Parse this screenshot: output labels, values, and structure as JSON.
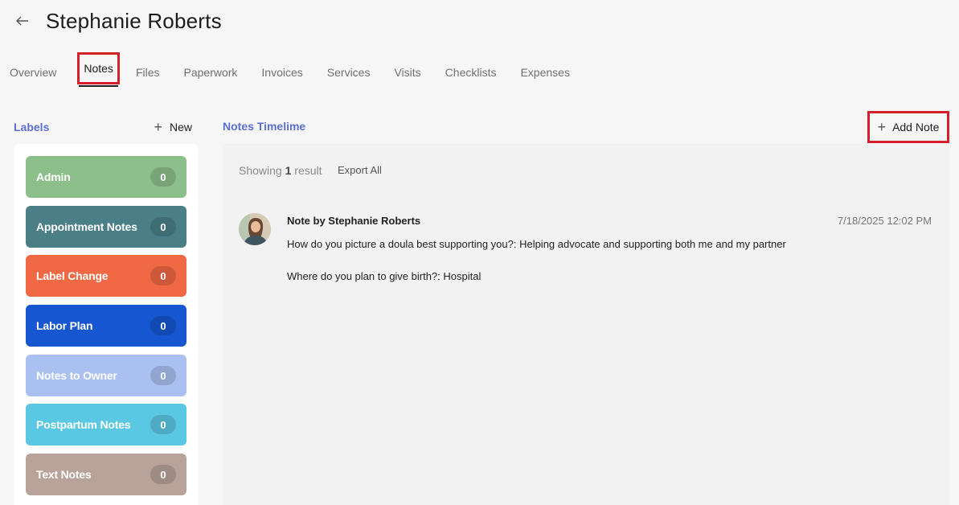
{
  "header": {
    "title": "Stephanie Roberts",
    "back_icon": "arrow-left-icon"
  },
  "tabs": [
    {
      "label": "Overview"
    },
    {
      "label": "Notes",
      "active": true
    },
    {
      "label": "Files"
    },
    {
      "label": "Paperwork"
    },
    {
      "label": "Invoices"
    },
    {
      "label": "Services"
    },
    {
      "label": "Visits"
    },
    {
      "label": "Checklists"
    },
    {
      "label": "Expenses"
    }
  ],
  "labels": {
    "title": "Labels",
    "new_label": "New",
    "items": [
      {
        "name": "Admin",
        "count": "0",
        "color": "#8dbf8b"
      },
      {
        "name": "Appointment Notes",
        "count": "0",
        "color": "#4a7f87"
      },
      {
        "name": "Label Change",
        "count": "0",
        "color": "#f06844"
      },
      {
        "name": "Labor Plan",
        "count": "0",
        "color": "#1656d1"
      },
      {
        "name": "Notes to Owner",
        "count": "0",
        "color": "#a9c0f0"
      },
      {
        "name": "Postpartum Notes",
        "count": "0",
        "color": "#5bc8e3"
      },
      {
        "name": "Text Notes",
        "count": "0",
        "color": "#b8a29a"
      }
    ]
  },
  "timeline": {
    "title": "Notes Timelime",
    "add_note_label": "Add Note",
    "showing_prefix": "Showing",
    "showing_count": "1",
    "showing_suffix": "result",
    "export_label": "Export All",
    "notes": [
      {
        "author": "Note by Stephanie Roberts",
        "date": "7/18/2025 12:02 PM",
        "lines": [
          "How do you picture a doula best supporting you?: Helping advocate and supporting both me and my partner",
          "Where do you plan to give birth?: Hospital"
        ]
      }
    ]
  }
}
